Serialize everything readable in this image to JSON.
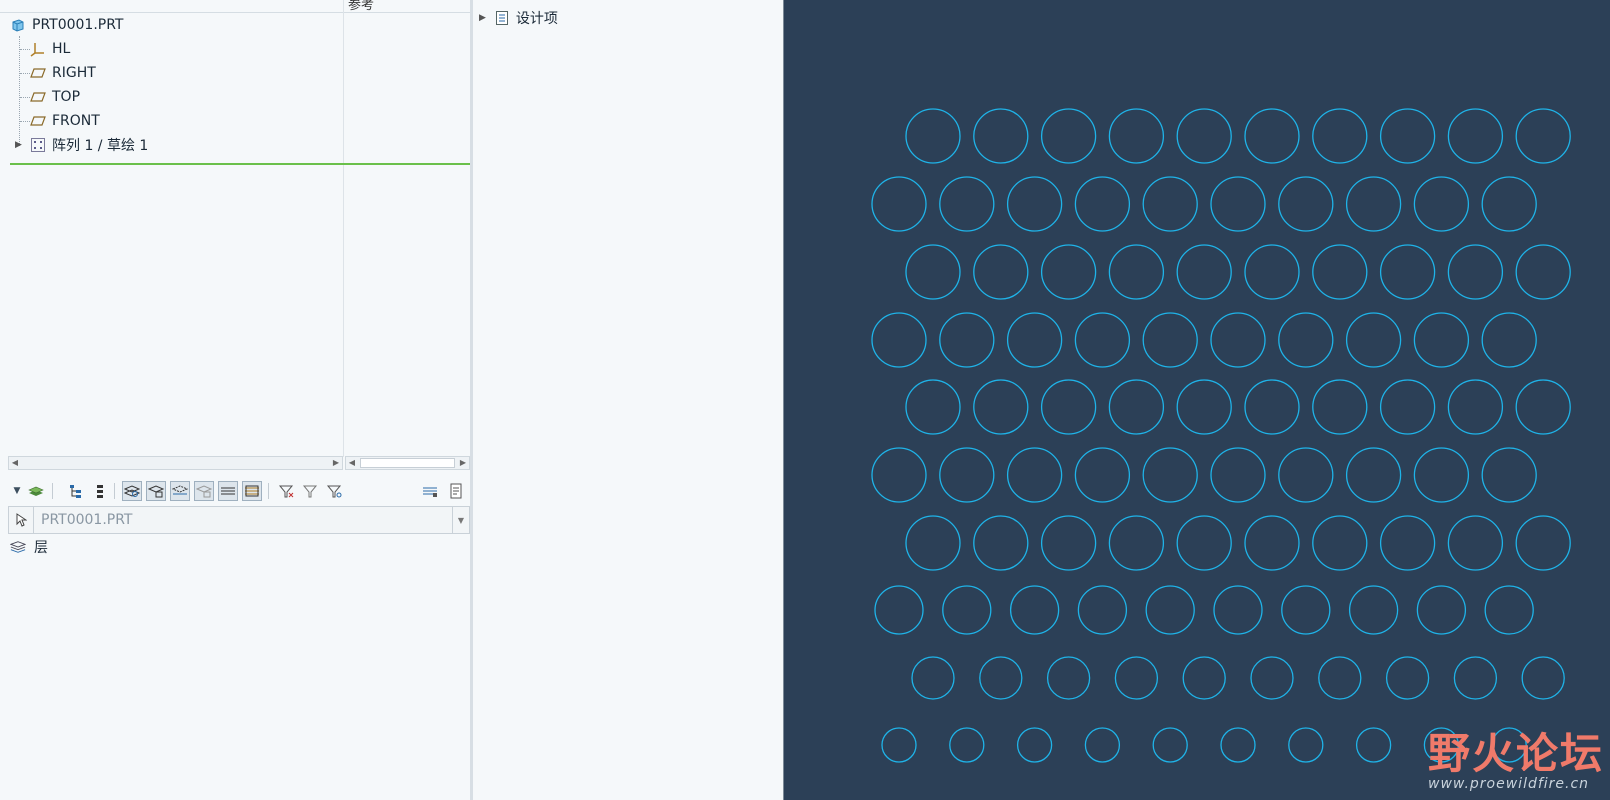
{
  "model_tree": {
    "col_header_ref": "参考",
    "root": {
      "label": "PRT0001.PRT",
      "icon": "part-icon"
    },
    "items": [
      {
        "label": "HL",
        "icon": "csys-icon"
      },
      {
        "label": "RIGHT",
        "icon": "datum-plane-icon"
      },
      {
        "label": "TOP",
        "icon": "datum-plane-icon"
      },
      {
        "label": "FRONT",
        "icon": "datum-plane-icon"
      },
      {
        "label": "阵列 1 / 草绘 1",
        "icon": "pattern-icon"
      }
    ]
  },
  "layer_panel": {
    "model_value": "PRT0001.PRT",
    "layer_root_label": "层"
  },
  "mid_panel": {
    "item_label": "设计项"
  },
  "watermark": {
    "main": "野火论坛",
    "url": "www.proewildfire.cn"
  },
  "colors": {
    "viewport_bg": "#2c4057",
    "sketch_circle": "#1fb3e8",
    "insert_indicator": "#6ac04a"
  }
}
